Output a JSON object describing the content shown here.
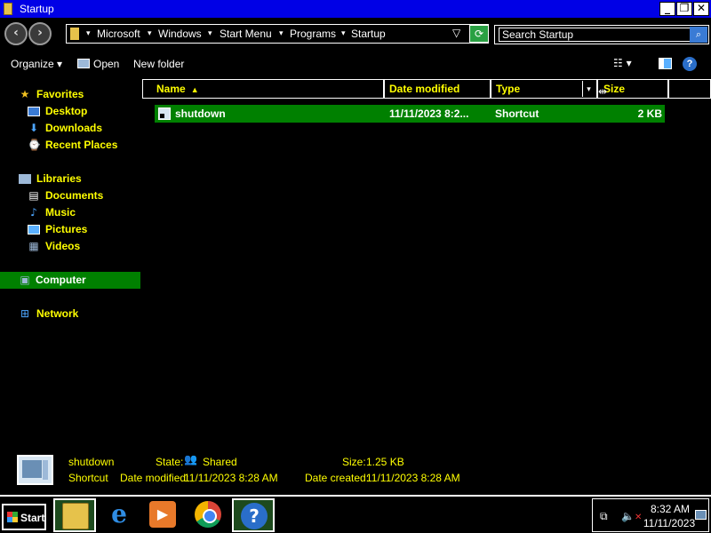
{
  "window": {
    "title": "Startup",
    "controls": {
      "minimize": "_",
      "maximize": "❐",
      "close": "✕"
    }
  },
  "address": {
    "breadcrumbs": [
      "Microsoft",
      "Windows",
      "Start Menu",
      "Programs",
      "Startup"
    ],
    "dropdown": "▽",
    "refresh_icon": "refresh-icon"
  },
  "search": {
    "placeholder": "Search Startup",
    "value": "Search Startup"
  },
  "toolbar": {
    "organize_label": "Organize",
    "organize_arrow": "▾",
    "open_label": "Open",
    "new_folder_label": "New folder",
    "views_glyph": "☷  ▾",
    "help_glyph": "?"
  },
  "nav": {
    "favorites": {
      "label": "Favorites",
      "items": [
        {
          "label": "Desktop",
          "icon": "desktop-icon"
        },
        {
          "label": "Downloads",
          "icon": "downloads-icon"
        },
        {
          "label": "Recent Places",
          "icon": "recent-places-icon"
        }
      ]
    },
    "libraries": {
      "label": "Libraries",
      "items": [
        {
          "label": "Documents",
          "icon": "documents-icon"
        },
        {
          "label": "Music",
          "icon": "music-icon"
        },
        {
          "label": "Pictures",
          "icon": "pictures-icon"
        },
        {
          "label": "Videos",
          "icon": "videos-icon"
        }
      ]
    },
    "computer": {
      "label": "Computer",
      "selected": true
    },
    "network": {
      "label": "Network"
    }
  },
  "columns": {
    "name": "Name",
    "date_modified": "Date modified",
    "type": "Type",
    "size": "Size",
    "sort_arrow": "▲",
    "type_dropdown": "▾"
  },
  "files": [
    {
      "name": "shutdown",
      "date_modified": "11/11/2023 8:2...",
      "type": "Shortcut",
      "size": "2 KB",
      "selected": true
    }
  ],
  "details": {
    "name": "shutdown",
    "type": "Shortcut",
    "state_label": "State:",
    "state_value": "Shared",
    "size_label": "Size:",
    "size_value": "1.25 KB",
    "date_modified_label": "Date modified:",
    "date_modified_value": "11/11/2023 8:28 AM",
    "date_created_label": "Date created:",
    "date_created_value": "11/11/2023 8:28 AM"
  },
  "taskbar": {
    "start_label": "Start",
    "apps": [
      {
        "name": "Windows Explorer",
        "icon": "folder-icon",
        "active": false
      },
      {
        "name": "Internet Explorer",
        "icon": "ie-icon",
        "active": false
      },
      {
        "name": "Windows Media Player",
        "icon": "media-player-icon",
        "active": false
      },
      {
        "name": "Google Chrome",
        "icon": "chrome-icon",
        "active": false
      },
      {
        "name": "Help and Support",
        "icon": "help-icon",
        "active": true
      }
    ],
    "clock": {
      "time": "8:32 AM",
      "date": "11/11/2023"
    }
  },
  "colors": {
    "titlebar": "#0000e6",
    "selection": "#008000",
    "text_highlight": "#ffff00",
    "background": "#000000"
  }
}
